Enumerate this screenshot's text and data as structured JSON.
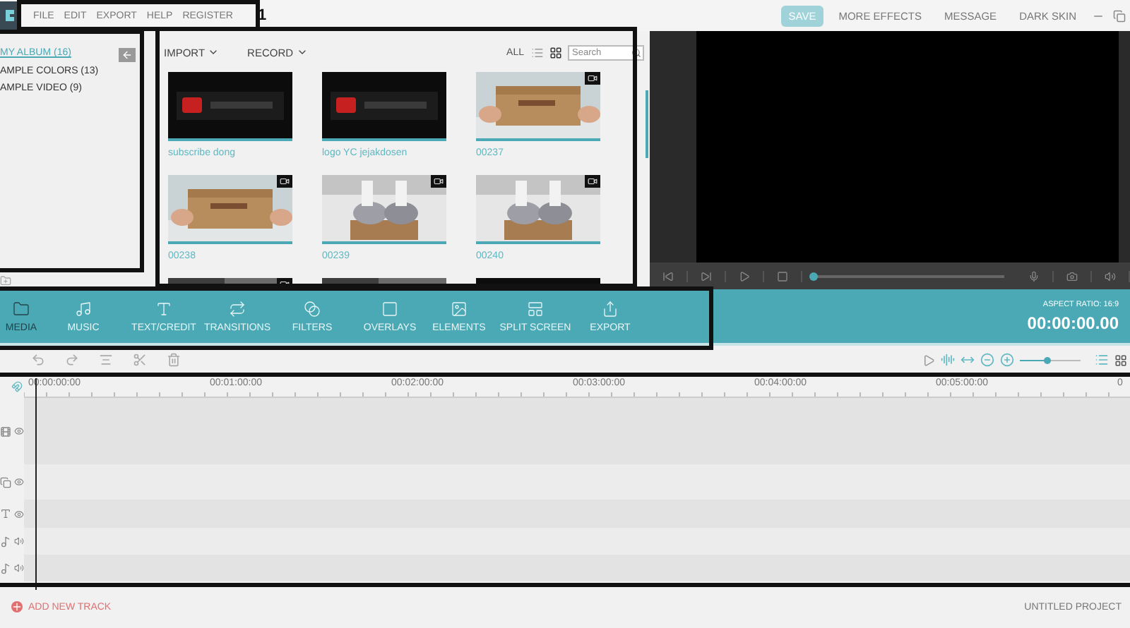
{
  "menu": [
    "FILE",
    "EDIT",
    "EXPORT",
    "HELP",
    "REGISTER"
  ],
  "annotation_label": "1",
  "top_actions": [
    {
      "label": "SAVE",
      "kind": "primary"
    },
    {
      "label": "MORE EFFECTS",
      "kind": "link"
    },
    {
      "label": "MESSAGE",
      "kind": "link"
    },
    {
      "label": "DARK SKIN",
      "kind": "link"
    }
  ],
  "albums": [
    {
      "label": "MY ALBUM (16)",
      "selected": true
    },
    {
      "label": "AMPLE COLORS (13)",
      "selected": false
    },
    {
      "label": "AMPLE VIDEO (9)",
      "selected": false
    }
  ],
  "media_toolbar": {
    "import": "IMPORT",
    "record": "RECORD",
    "filter": "ALL",
    "search": {
      "placeholder": "Search"
    }
  },
  "media": [
    {
      "title": "subscribe dong",
      "video": false
    },
    {
      "title": "logo YC jejakdosen",
      "video": false
    },
    {
      "title": "00237",
      "video": true
    },
    {
      "title": "00238",
      "video": true
    },
    {
      "title": "00239",
      "video": true
    },
    {
      "title": "00240",
      "video": true
    },
    {
      "video": true
    },
    {
      "video": false
    },
    {
      "video": false
    }
  ],
  "preview": {
    "progress": {
      "level": 0
    }
  },
  "tabs": [
    {
      "label": "MEDIA",
      "selected": true
    },
    {
      "label": "MUSIC",
      "selected": false
    },
    {
      "label": "TEXT/CREDIT",
      "selected": false
    },
    {
      "label": "TRANSITIONS",
      "selected": false
    },
    {
      "label": "FILTERS",
      "selected": false
    },
    {
      "label": "OVERLAYS",
      "selected": false
    },
    {
      "label": "ELEMENTS",
      "selected": false
    },
    {
      "label": "SPLIT SCREEN",
      "selected": false
    },
    {
      "label": "EXPORT",
      "selected": false
    }
  ],
  "aspect_ratio": "ASPECT RATIO: 16:9",
  "timecode": "00:00:00.00",
  "zoom": {
    "level": 0.45
  },
  "ruler": [
    "00:00:00:00",
    "00:01:00:00",
    "00:02:00:00",
    "00:03:00:00",
    "00:04:00:00",
    "00:05:00:00",
    "0"
  ],
  "tracks": [
    {
      "kind": "video"
    },
    {
      "kind": "overlay"
    },
    {
      "kind": "text"
    },
    {
      "kind": "audio"
    },
    {
      "kind": "audio"
    }
  ],
  "footer": {
    "add_track": "ADD NEW TRACK",
    "project": "UNTITLED PROJECT"
  }
}
